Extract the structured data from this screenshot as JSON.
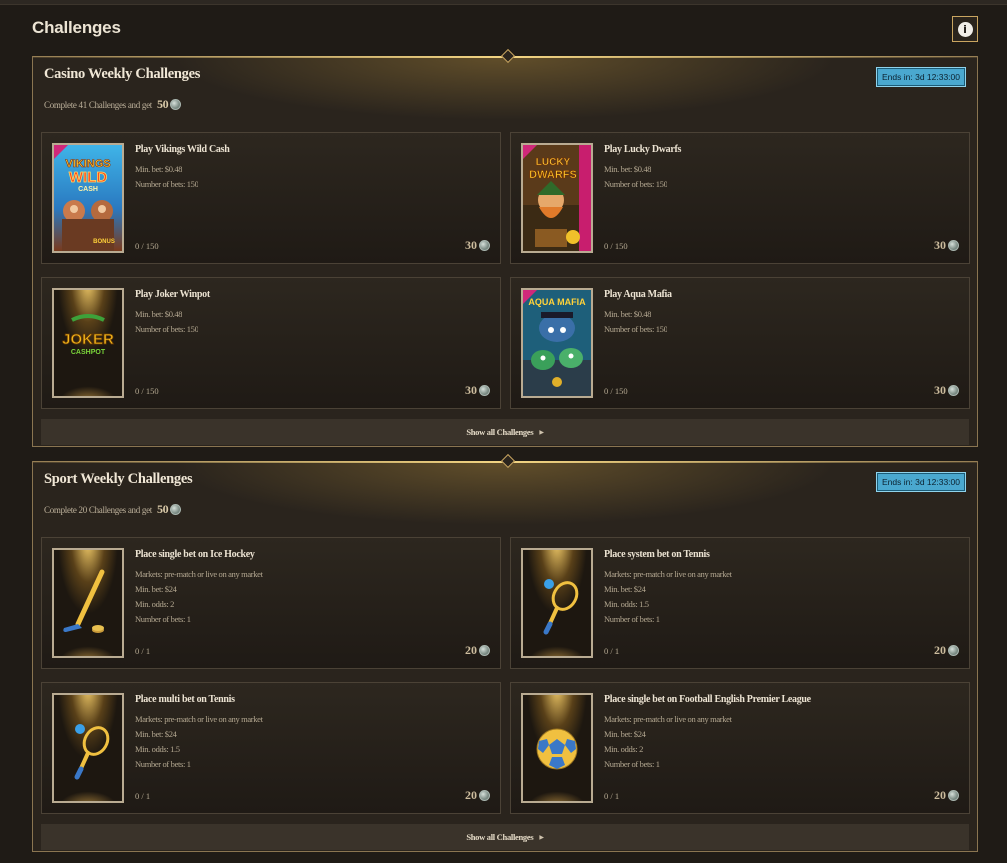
{
  "page": {
    "title": "Challenges"
  },
  "sections": [
    {
      "title": "Casino Weekly Challenges",
      "subtitle": "Complete 41 Challenges and get",
      "reward": "50",
      "ends": "Ends in: 3d 12:33:00",
      "show_all": "Show all Challenges",
      "cards": [
        {
          "title": "Play Vikings Wild Cash",
          "lines": [
            "Min. bet: $0.48",
            "Number of bets: 150"
          ],
          "progress": "0 / 150",
          "reward": "30",
          "art": "vikings-wild-cash-art"
        },
        {
          "title": "Play Lucky Dwarfs",
          "lines": [
            "Min. bet: $0.48",
            "Number of bets: 150"
          ],
          "progress": "0 / 150",
          "reward": "30",
          "art": "lucky-dwarfs-art"
        },
        {
          "title": "Play Joker Winpot",
          "lines": [
            "Min. bet: $0.48",
            "Number of bets: 150"
          ],
          "progress": "0 / 150",
          "reward": "30",
          "art": "joker-cashpot-art"
        },
        {
          "title": "Play Aqua Mafia",
          "lines": [
            "Min. bet: $0.48",
            "Number of bets: 150"
          ],
          "progress": "0 / 150",
          "reward": "30",
          "art": "aqua-mafia-art"
        }
      ]
    },
    {
      "title": "Sport Weekly Challenges",
      "subtitle": "Complete 20 Challenges and get",
      "reward": "50",
      "ends": "Ends in: 3d 12:33:00",
      "show_all": "Show all Challenges",
      "cards": [
        {
          "title": "Place single bet on Ice Hockey",
          "lines": [
            "Markets: pre-match or live on any market",
            "Min. bet: $24",
            "Min. odds: 2",
            "Number of bets: 1"
          ],
          "progress": "0 / 1",
          "reward": "20",
          "art": "hockey-stick-icon"
        },
        {
          "title": "Place system bet on Tennis",
          "lines": [
            "Markets: pre-match or live on any market",
            "Min. bet: $24",
            "Min. odds: 1.5",
            "Number of bets: 1"
          ],
          "progress": "0 / 1",
          "reward": "20",
          "art": "tennis-racket-icon"
        },
        {
          "title": "Place multi bet on Tennis",
          "lines": [
            "Markets: pre-match or live on any market",
            "Min. bet: $24",
            "Min. odds: 1.5",
            "Number of bets: 1"
          ],
          "progress": "0 / 1",
          "reward": "20",
          "art": "tennis-racket-icon"
        },
        {
          "title": "Place single bet on Football English Premier League",
          "lines": [
            "Markets: pre-match or live on any market",
            "Min. bet: $24",
            "Min. odds: 2",
            "Number of bets: 1"
          ],
          "progress": "0 / 1",
          "reward": "20",
          "art": "football-icon"
        }
      ]
    }
  ]
}
